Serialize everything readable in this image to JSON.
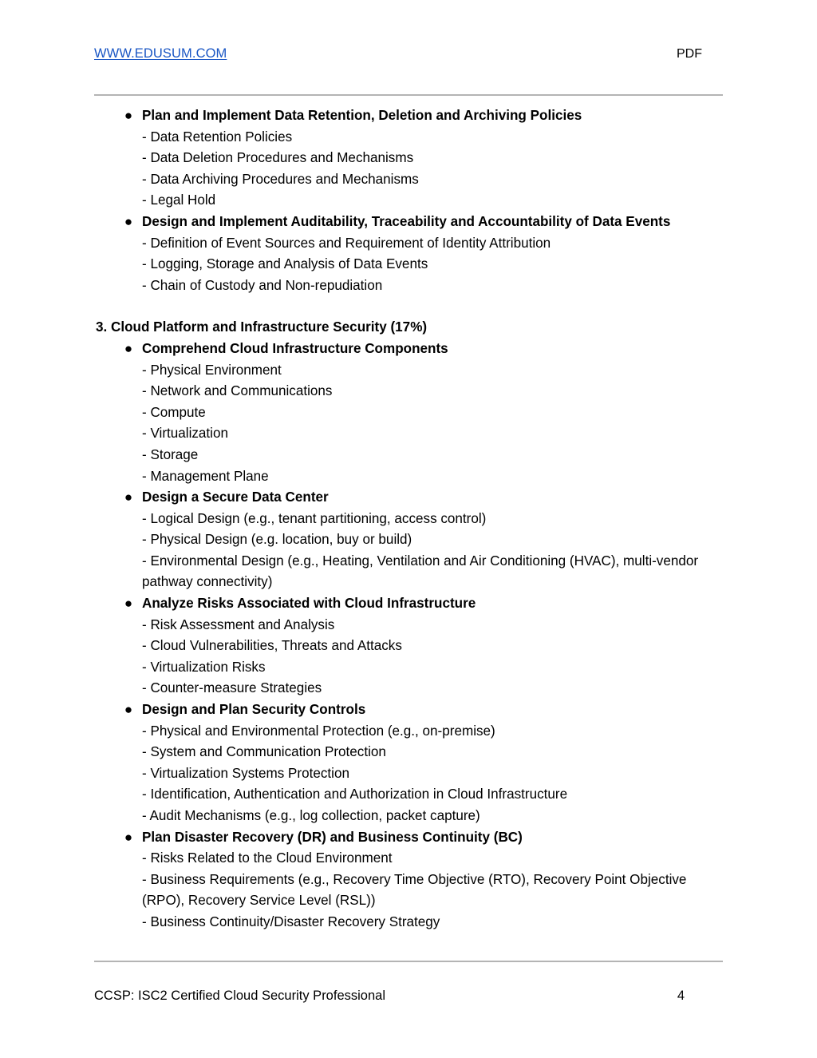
{
  "header": {
    "site_link": "WWW.EDUSUM.COM",
    "doc_kind": "PDF",
    "link_color": "#1a56c4"
  },
  "content": {
    "continued_groups": [
      {
        "title": "Plan and Implement Data Retention, Deletion and Archiving Policies",
        "items": [
          "- Data Retention Policies",
          "- Data Deletion Procedures and Mechanisms",
          "- Data Archiving Procedures and Mechanisms",
          "- Legal Hold"
        ]
      },
      {
        "title": "Design and Implement Auditability, Traceability and Accountability of Data Events",
        "items": [
          "- Definition of Event Sources and Requirement of Identity Attribution",
          "- Logging, Storage and Analysis of Data Events",
          "- Chain of Custody and Non-repudiation"
        ]
      }
    ],
    "section": {
      "heading": "3. Cloud Platform and Infrastructure Security (17%)",
      "groups": [
        {
          "title": "Comprehend Cloud Infrastructure Components",
          "items": [
            "- Physical Environment",
            "- Network and Communications",
            "- Compute",
            "- Virtualization",
            "- Storage",
            "- Management Plane"
          ]
        },
        {
          "title": "Design a Secure Data Center",
          "items": [
            "- Logical Design (e.g., tenant partitioning, access control)",
            "- Physical Design (e.g. location, buy or build)",
            "- Environmental Design (e.g., Heating, Ventilation and Air Conditioning (HVAC), multi-vendor pathway connectivity)"
          ]
        },
        {
          "title": "Analyze Risks Associated with Cloud Infrastructure",
          "items": [
            "- Risk Assessment and Analysis",
            "- Cloud Vulnerabilities, Threats and Attacks",
            "- Virtualization Risks",
            "- Counter-measure Strategies"
          ]
        },
        {
          "title": "Design and Plan Security Controls",
          "items": [
            "- Physical and Environmental Protection (e.g., on-premise)",
            "- System and Communication Protection",
            "- Virtualization Systems Protection",
            "- Identification, Authentication and Authorization in Cloud Infrastructure",
            "- Audit Mechanisms (e.g., log collection, packet capture)"
          ]
        },
        {
          "title": "Plan Disaster Recovery (DR) and Business Continuity (BC)",
          "items": [
            "- Risks Related to the Cloud Environment",
            "- Business Requirements (e.g., Recovery Time Objective (RTO), Recovery Point Objective (RPO), Recovery Service Level (RSL))",
            "- Business Continuity/Disaster Recovery Strategy"
          ]
        }
      ]
    },
    "bullet_glyph": "●"
  },
  "footer": {
    "title": "CCSP: ISC2 Certified Cloud Security Professional",
    "page_number": "4"
  }
}
